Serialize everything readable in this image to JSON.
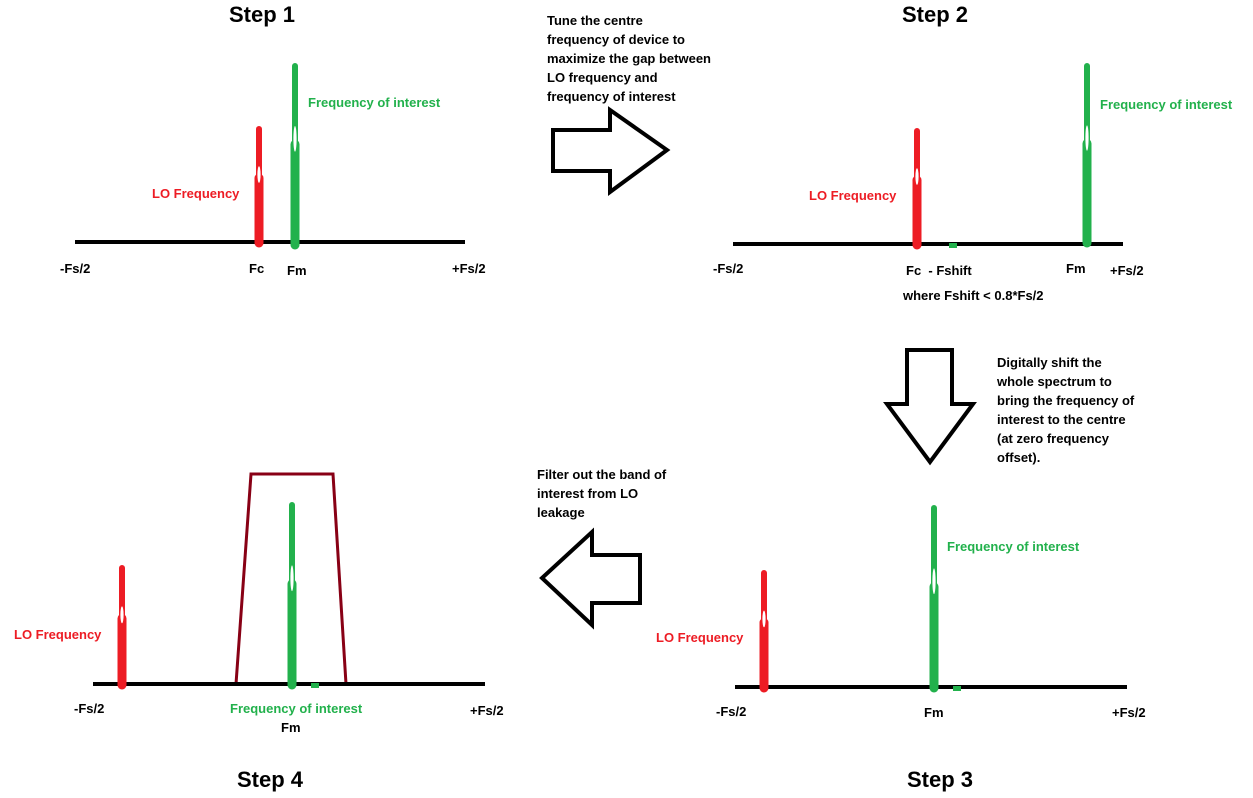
{
  "colors": {
    "lo": "#ed1c24",
    "interest": "#22b14c",
    "filter": "#880015",
    "axis": "#000000"
  },
  "step1": {
    "title": "Step 1",
    "interest_label": "Frequency of interest",
    "lo_label": "LO Frequency",
    "neg": "-Fs/2",
    "fc": "Fc",
    "fm": "Fm",
    "pos": "+Fs/2"
  },
  "step2": {
    "title": "Step 2",
    "interest_label": "Frequency of interest",
    "lo_label": "LO Frequency",
    "neg": "-Fs/2",
    "fc": "Fc  - Fshift",
    "fm": "Fm",
    "pos": "+Fs/2",
    "condition": "where Fshift < 0.8*Fs/2"
  },
  "step3": {
    "title": "Step 3",
    "interest_label": "Frequency of interest",
    "lo_label": "LO Frequency",
    "neg": "-Fs/2",
    "fm": "Fm",
    "pos": "+Fs/2"
  },
  "step4": {
    "title": "Step 4",
    "interest_label": "Frequency of interest",
    "lo_label": "LO Frequency",
    "neg": "-Fs/2",
    "fm": "Fm",
    "pos": "+Fs/2"
  },
  "arrow1_text": [
    "Tune the centre",
    "frequency of device to",
    "maximize the gap between",
    "LO frequency and",
    "frequency of interest"
  ],
  "arrow2_text": [
    "Digitally shift the",
    "whole spectrum to",
    "bring the frequency of",
    "interest to the centre",
    "(at zero frequency",
    "offset)."
  ],
  "arrow3_text": [
    "Filter out the band of",
    "interest from LO",
    "leakage"
  ]
}
